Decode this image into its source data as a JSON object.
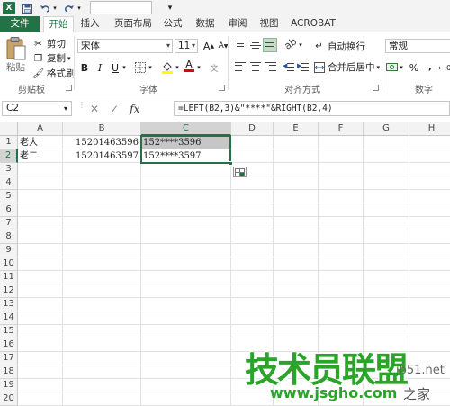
{
  "quick_access": {
    "app_icon_letter": "X"
  },
  "tabs": [
    "文件",
    "开始",
    "插入",
    "页面布局",
    "公式",
    "数据",
    "审阅",
    "视图",
    "ACROBAT"
  ],
  "active_tab": "开始",
  "ribbon": {
    "clipboard": {
      "paste": "粘贴",
      "cut": "剪切",
      "copy": "复制",
      "format_painter": "格式刷",
      "group_label": "剪贴板"
    },
    "font": {
      "name": "宋体",
      "size": "11",
      "grow": "A",
      "shrink": "A",
      "bold": "B",
      "italic": "I",
      "underline": "U",
      "font_color_letter": "A",
      "group_label": "字体"
    },
    "alignment": {
      "wrap_text": "自动换行",
      "merge_center": "合并后居中",
      "group_label": "对齐方式"
    },
    "number": {
      "format": "常规",
      "percent": "%",
      "comma": ",",
      "group_label": "数字"
    }
  },
  "formula_bar": {
    "name_box": "C2",
    "fx": "fx",
    "formula": "=LEFT(B2,3)&\"****\"&RIGHT(B2,4)"
  },
  "sheet": {
    "columns": [
      "A",
      "B",
      "C",
      "D",
      "E",
      "F",
      "G",
      "H"
    ],
    "rows": [
      "1",
      "2",
      "3",
      "4",
      "5",
      "6",
      "7",
      "8",
      "9",
      "10",
      "11",
      "12",
      "13",
      "14",
      "15",
      "16",
      "17",
      "18",
      "19",
      "20"
    ],
    "cells": {
      "A1": "老大",
      "B1": "15201463596",
      "C1": "152****3596",
      "A2": "老二",
      "B2": "15201463597",
      "C2": "152****3597"
    }
  },
  "watermark": {
    "logo_text": "技术员联盟",
    "url": "www.jsgho.com",
    "side_text": "jb51.net",
    "side_text2": "之家"
  },
  "colors": {
    "excel_green": "#217346",
    "watermark_green": "#2aa52a"
  }
}
